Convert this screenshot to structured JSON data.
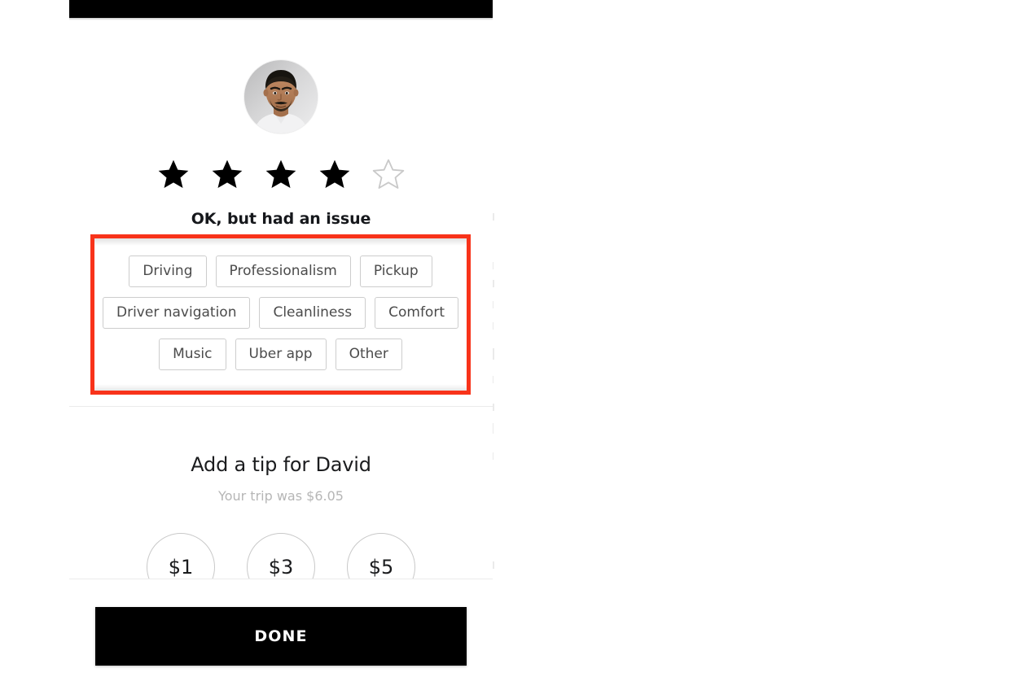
{
  "app": {
    "status_bar_color": "#000000",
    "background_color": "#ffffff"
  },
  "driver": {
    "avatar": "driver-avatar-photo",
    "name": "David"
  },
  "rating": {
    "value": 4,
    "max": 5,
    "label": "OK, but had an issue",
    "filled_star_color": "#000000",
    "empty_star_color": "#c9c9c9"
  },
  "issue_tags": {
    "highlight_color": "#f8331a",
    "rows": [
      [
        "Driving",
        "Professionalism",
        "Pickup"
      ],
      [
        "Driver navigation",
        "Cleanliness",
        "Comfort"
      ],
      [
        "Music",
        "Uber app",
        "Other"
      ]
    ]
  },
  "tip": {
    "title": "Add a tip for David",
    "subtitle": "Your trip was $6.05",
    "trip_amount": "$6.05",
    "options": [
      "$1",
      "$3",
      "$5"
    ]
  },
  "footer": {
    "done_label": "DONE"
  }
}
